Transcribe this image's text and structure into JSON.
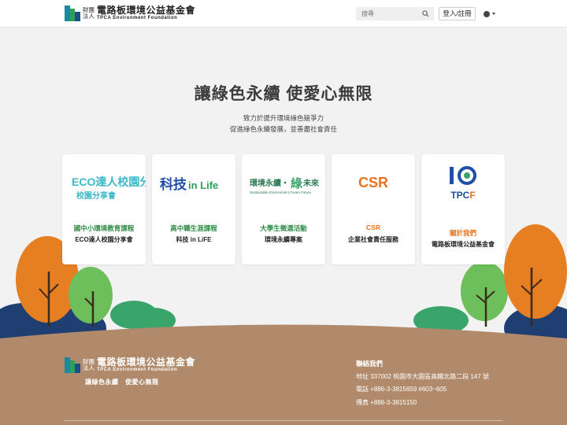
{
  "header": {
    "logo_small": "財團法人",
    "logo_cn": "電路板環境公益基金會",
    "logo_en": "TPCA Environment Foundation",
    "search_placeholder": "搜尋",
    "login_label": "登入/註冊"
  },
  "hero": {
    "title": "讓綠色永續 使愛心無限",
    "subtitle_line1": "致力於提升環境綠色競爭力",
    "subtitle_line2": "促進綠色永續發展，並善盡社會責任"
  },
  "cards": [
    {
      "logo_text": "ECO達人校園分享會",
      "category": "國中小環境教育課程",
      "name": "ECO達人校園分享會",
      "color": "#2d8a45"
    },
    {
      "logo_text": "科技inLife",
      "category": "高中職生涯課程",
      "name": "科技 in LiFE",
      "color": "#2d8a45"
    },
    {
      "logo_text": "環境永續・綠未來",
      "logo_sub": "Sustainable Environment Green Future",
      "category": "大學生徵選活動",
      "name": "環境永續專案",
      "color": "#2d8a45"
    },
    {
      "logo_text": "CSR",
      "category": "CSR",
      "name": "企業社會責任服務",
      "color": "#e8731f"
    },
    {
      "logo_text": "10",
      "logo_sub": "TPCF",
      "category": "關於我們",
      "name": "電路板環境公益基金會",
      "color": "#e8731f"
    }
  ],
  "footer": {
    "logo_small": "財團法人",
    "logo_cn": "電路板環境公益基金會",
    "logo_en": "TPCA Environment Foundation",
    "slogan": "讓綠色永續　使愛心無限",
    "contact_title": "聯絡我們",
    "address": "地址 337002 桃園市大園區高鐵北路二段 147 號",
    "phone": "電話 +886-3-3815659 #603~605",
    "fax": "傳真 +886-3-3815150"
  },
  "colors": {
    "green": "#2d8a45",
    "orange": "#e8731f",
    "footer_brown": "#b08a6b",
    "tree_orange": "#e67e22",
    "tree_green": "#6cbf5a",
    "bush_navy": "#1f3f73"
  }
}
